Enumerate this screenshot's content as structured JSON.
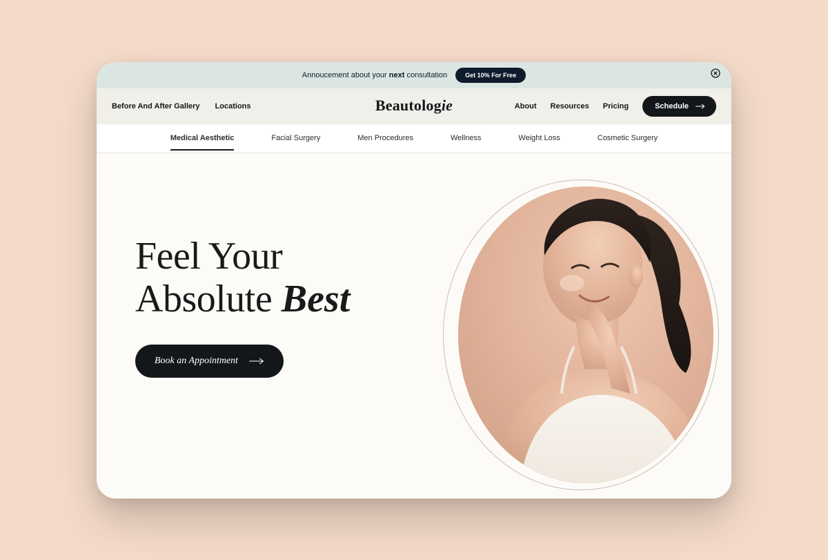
{
  "announcement": {
    "prefix": "Annoucement about your ",
    "bold": "next",
    "suffix": " consultation",
    "pill_label": "Get 10% For Free"
  },
  "header": {
    "left_links": [
      "Before And After Gallery",
      "Locations"
    ],
    "brand_plain": "Beautolog",
    "brand_italic": "ie",
    "right_links": [
      "About",
      "Resources",
      "Pricing"
    ],
    "schedule_label": "Schedule"
  },
  "subnav": {
    "items": [
      {
        "label": "Medical Aesthetic",
        "active": true
      },
      {
        "label": "Facial Surgery",
        "active": false
      },
      {
        "label": "Men Procedures",
        "active": false
      },
      {
        "label": "Wellness",
        "active": false
      },
      {
        "label": "Weight Loss",
        "active": false
      },
      {
        "label": "Cosmetic Surgery",
        "active": false
      }
    ]
  },
  "hero": {
    "line1": "Feel Your",
    "line2_plain": "Absolute ",
    "line2_emph": "Best",
    "cta_label": "Book an Appointment"
  }
}
